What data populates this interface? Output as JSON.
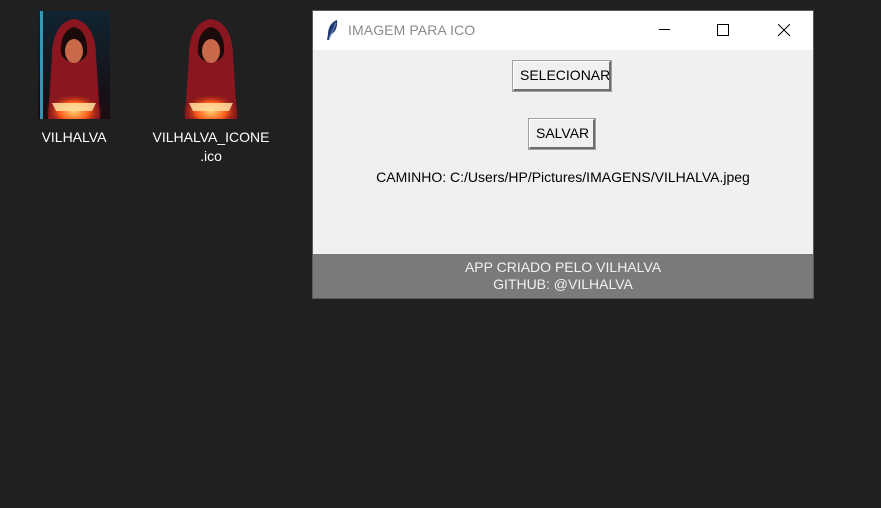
{
  "desktop": {
    "icons": [
      {
        "label": "VILHALVA",
        "icon": "hooded-figure-image-icon"
      },
      {
        "label_line1": "VILHALVA_ICONE",
        "label_line2": ".ico",
        "icon": "hooded-figure-ico-icon"
      }
    ]
  },
  "window": {
    "title": "IMAGEM PARA ICO",
    "title_icon": "feather-icon",
    "controls": {
      "minimize_icon": "minimize-icon",
      "maximize_icon": "maximize-icon",
      "close_icon": "close-icon"
    },
    "buttons": {
      "select_label": "SELECIONAR",
      "save_label": "SALVAR"
    },
    "path_label": "CAMINHO: C:/Users/HP/Pictures/IMAGENS/VILHALVA.jpeg",
    "footer": {
      "line1": "APP CRIADO PELO VILHALVA",
      "line2": "GITHUB: @VILHALVA"
    }
  },
  "colors": {
    "desktop_bg": "#202020",
    "window_bg": "#f0f0f0",
    "footer_bg": "#7a7a7a"
  }
}
